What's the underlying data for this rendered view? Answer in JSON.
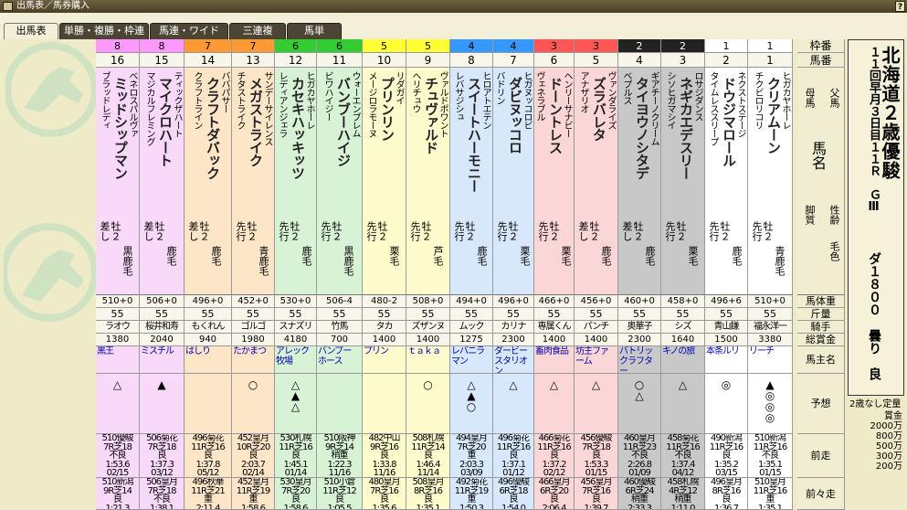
{
  "window_title": "出馬表／馬券購入",
  "help_label": "?",
  "tabs": [
    "出馬表",
    "単勝・複勝・枠連",
    "馬連・ワイド",
    "三連複",
    "馬単"
  ],
  "header": {
    "gate": "枠番",
    "num": "馬番",
    "dam": "母馬",
    "sire": "父馬",
    "name": "馬名",
    "style": "脚質",
    "sex": "性齢",
    "coat": "毛色",
    "weight": "馬体重",
    "kg": "斤量",
    "jockey": "騎手",
    "prize": "総賞金",
    "owner": "馬主名",
    "pred": "予想",
    "prev1": "前走",
    "prev2": "前々走"
  },
  "race": {
    "title": "北海道２歳優駿",
    "sub": "１１回早月３日目１１Ｒ　ＧⅢ",
    "detail": "ダ１８００　曇り　良"
  },
  "prize_table": {
    "title": "2歳なし定量",
    "label": "賞金",
    "values": [
      "2000万",
      "800万",
      "500万",
      "300万",
      "200万"
    ]
  },
  "colors": {
    "gate8": "#ff99ff",
    "gate7": "#ff9933",
    "gate6": "#33cc33",
    "gate5": "#ffff33",
    "gate4": "#3399ff",
    "gate3": "#ff5555",
    "gate2": "#222222",
    "gate1": "#ffffff"
  },
  "horses": [
    {
      "gate": "8",
      "num": "16",
      "sire": "ベネロスパルヴァ",
      "name": "ミッドシップマン",
      "dam": "ブラッドレディ",
      "style": "差し",
      "sex": "牡２",
      "coat": "黒鹿毛",
      "weight": "510+0",
      "kg": "55",
      "jockey": "ラオウ",
      "prize": "1380",
      "owner": "黒王",
      "pred": "△",
      "prev1": "510優駿\n7R芝18\n不良\n1:53.6\n02/15",
      "prev2": "510新潟\n9R芝14\n良\n1:21.3\n03/18"
    },
    {
      "gate": "8",
      "num": "15",
      "sire": "ティックザハート",
      "name": "マイクロハート",
      "dam": "マジカルフレミング",
      "style": "差し",
      "sex": "牡２",
      "coat": "鹿毛",
      "weight": "506+0",
      "kg": "55",
      "jockey": "桜井和寿",
      "prize": "2040",
      "owner": "ミスチル",
      "pred": "▲",
      "prev1": "506菊花\n7R芝18\n良\n1:37.3\n03/12",
      "prev2": "506皇月\n7R芝18\n不良\n1:38.1\n01/13"
    },
    {
      "gate": "7",
      "num": "14",
      "sire": "ババパサー",
      "name": "クラフトダバック",
      "dam": "クラフトライン",
      "style": "差し",
      "sex": "牡２",
      "coat": "鹿毛",
      "weight": "496+0",
      "kg": "55",
      "jockey": "もくれん",
      "prize": "940",
      "owner": "はしり",
      "pred": "",
      "prev1": "496菊花\n11R芝16\n良\n1:37.8\n05/12",
      "prev2": "496秋華\n11R芝21\n重\n2:11.4\n01/05"
    },
    {
      "gate": "7",
      "num": "13",
      "sire": "サンデーサイレンス",
      "name": "メガストライク",
      "dam": "チタストライク",
      "style": "先行",
      "sex": "牡２",
      "coat": "青鹿毛",
      "weight": "452+0",
      "kg": "55",
      "jockey": "ゴルゴ",
      "prize": "1980",
      "owner": "たかまつ",
      "pred": "○",
      "prev1": "452皇月\n10R芝20\n良\n2:03.7\n02/14",
      "prev2": "452皇月\n11R芝19\n重\n1:58.6\n02/16"
    },
    {
      "gate": "6",
      "num": "12",
      "sire": "ヒガカヤホーレ",
      "name": "カセキハッキッツ",
      "dam": "レディアンジェラ",
      "style": "先行",
      "sex": "牡２",
      "coat": "鹿毛",
      "weight": "530+0",
      "kg": "55",
      "jockey": "スナズリ",
      "prize": "4180",
      "owner": "アレック\n牧場",
      "pred": "△▲△",
      "prev1": "530札幌\n11R芝16\n良\n1:45.1\n01/14",
      "prev2": "530皇月\n7R芝20\n良\n1:58.6\n02/10"
    },
    {
      "gate": "6",
      "num": "11",
      "sire": "ウォーエンブレム",
      "name": "バンブーハイジ",
      "dam": "ビワハイジー",
      "style": "先行",
      "sex": "牡２",
      "coat": "黒鹿毛",
      "weight": "506-4",
      "kg": "55",
      "jockey": "竹馬",
      "prize": "700",
      "owner": "バンブー\nホース",
      "pred": "",
      "prev1": "510阪神\n9R芝14\n稍重\n1:22.3\n11/16",
      "prev2": "510小倉\n11R芝12\n良\n1:05.5\n10/18"
    },
    {
      "gate": "5",
      "num": "10",
      "sire": "リダガイ",
      "name": "プリンリン",
      "dam": "メージロラモーヌ",
      "style": "先行",
      "sex": "牡２",
      "coat": "栗毛",
      "weight": "480-2",
      "kg": "55",
      "jockey": "タカ",
      "prize": "1400",
      "owner": "プリン",
      "pred": "",
      "prev1": "482中山\n9R芝16\n良\n1:33.8\n11/16",
      "prev2": "480皇月\n7R芝16\n良\n1:35.6\n01/05"
    },
    {
      "gate": "5",
      "num": "9",
      "sire": "ヴァルドポワント",
      "name": "チュヴァルド",
      "dam": "ヘリチュウ",
      "style": "先行",
      "sex": "牡２",
      "coat": "芦毛",
      "weight": "508+0",
      "kg": "55",
      "jockey": "ズザンヌ",
      "prize": "1400",
      "owner": "ｔａｋａ",
      "pred": "○",
      "prev1": "508札幌\n11R芝14\n良\n1:46.4\n11/14",
      "prev2": "508皇月\n8R芝16\n良\n1:35.1\n01/12"
    },
    {
      "gate": "4",
      "num": "8",
      "sire": "ヒロアトエテン",
      "name": "スイートハーモニー",
      "dam": "レバサジシュ",
      "style": "先行",
      "sex": "牡２",
      "coat": "鹿毛",
      "weight": "494+0",
      "kg": "55",
      "jockey": "ムック",
      "prize": "1275",
      "owner": "レバニラ\nマン",
      "pred": "△▲○",
      "prev1": "494皇月\n7R芝20\n重\n2:03.3\n03/09",
      "prev2": "492菊花\n11R芝19\n重\n1:50.3\n03/16"
    },
    {
      "gate": "4",
      "num": "7",
      "sire": "ヒガヌッコロビ",
      "name": "ダビヌッコロ",
      "dam": "バドリン",
      "style": "先行",
      "sex": "牡２",
      "coat": "栗毛",
      "weight": "496+0",
      "kg": "55",
      "jockey": "カリナ",
      "prize": "2300",
      "owner": "ダービー\nスタリオ\nン",
      "pred": "△",
      "prev1": "496菊花\n11R芝16\n良\n1:37.1\n01/12",
      "prev2": "496優駿\n6R芝18\n良\n1:54.0\n01/09"
    },
    {
      "gate": "3",
      "num": "6",
      "sire": "ヘンリーサナビー",
      "name": "ドーントレス",
      "dam": "ヴェネラブル",
      "style": "先行",
      "sex": "牡２",
      "coat": "栗毛",
      "weight": "466+0",
      "kg": "55",
      "jockey": "専属くん",
      "prize": "1400",
      "owner": "畜肉食品",
      "pred": "△",
      "prev1": "466菊花\n11R芝16\n良\n1:37.2\n02/12",
      "prev2": "466皇月\n6R芝20\n良\n2:06.4\n01/07"
    },
    {
      "gate": "3",
      "num": "5",
      "sire": "ヴァンダライズ",
      "name": "ズラバレタ",
      "dam": "アナザリオ",
      "style": "差し",
      "sex": "牡２",
      "coat": "鹿毛",
      "weight": "456+0",
      "kg": "55",
      "jockey": "パンチ",
      "prize": "1400",
      "owner": "坊主ファ\nーム",
      "pred": "△",
      "prev1": "456優駿\n7R芝18\n良\n1:53.3\n01/15",
      "prev2": "456皇月\n7R芝16\n良\n1:39.7\n01/07"
    },
    {
      "gate": "2",
      "num": "4",
      "sire": "ギアチーノクリーム",
      "name": "タイヨウノシタデ",
      "dam": "ベプルス",
      "style": "差し",
      "sex": "牡２",
      "coat": "鹿毛",
      "weight": "460+0",
      "kg": "55",
      "jockey": "奥華子",
      "prize": "2300",
      "owner": "バトリッ\nクラフタ\nー",
      "pred": "○△",
      "prev1": "460皇月\n11R芝23\n不良\n2:26.8\n01/09",
      "prev2": "460優駿\n6R芝24\n稍重\n2:33.3\n01/05"
    },
    {
      "gate": "2",
      "num": "3",
      "sire": "ロサジダンス",
      "name": "ネギカエデスリー",
      "dam": "シソヒガマシイ",
      "style": "先行",
      "sex": "牡２",
      "coat": "栗毛",
      "weight": "458+0",
      "kg": "55",
      "jockey": "シズ",
      "prize": "1640",
      "owner": "キノの旅",
      "pred": "△",
      "prev1": "458菊花\n11R芝16\n不良\n1:37.4\n04/12",
      "prev2": "458札幌\n4R芝12\n稍重\n1:11.0\n01/08"
    },
    {
      "gate": "1",
      "num": "2",
      "sire": "ネクストステージ",
      "name": "ドウジマロール",
      "dam": "タイムレススリープ",
      "style": "先行",
      "sex": "牡２",
      "coat": "鹿毛",
      "weight": "496+6",
      "kg": "55",
      "jockey": "青山鎌",
      "prize": "1500",
      "owner": "本条ルリ",
      "pred": "◎",
      "prev1": "490新潟\n11R芝16\n良\n1:35.2\n03/15",
      "prev2": "496皇月\n8R芝16\n良\n1:36.7\n01/06"
    },
    {
      "gate": "1",
      "num": "1",
      "sire": "ヒガカヤホーレ",
      "name": "クリアムーン",
      "dam": "チクビロリコリ",
      "style": "先行",
      "sex": "牡２",
      "coat": "青鹿毛",
      "weight": "510+0",
      "kg": "55",
      "jockey": "福永洋一",
      "prize": "3380",
      "owner": "リーチ",
      "pred": "▲◎◎◎",
      "prev1": "510新潟\n11R芝16\n不良\n1:35.1\n01/15",
      "prev2": "510皇月\n11R芝16\n重\n1:35.1\n01/11"
    }
  ]
}
